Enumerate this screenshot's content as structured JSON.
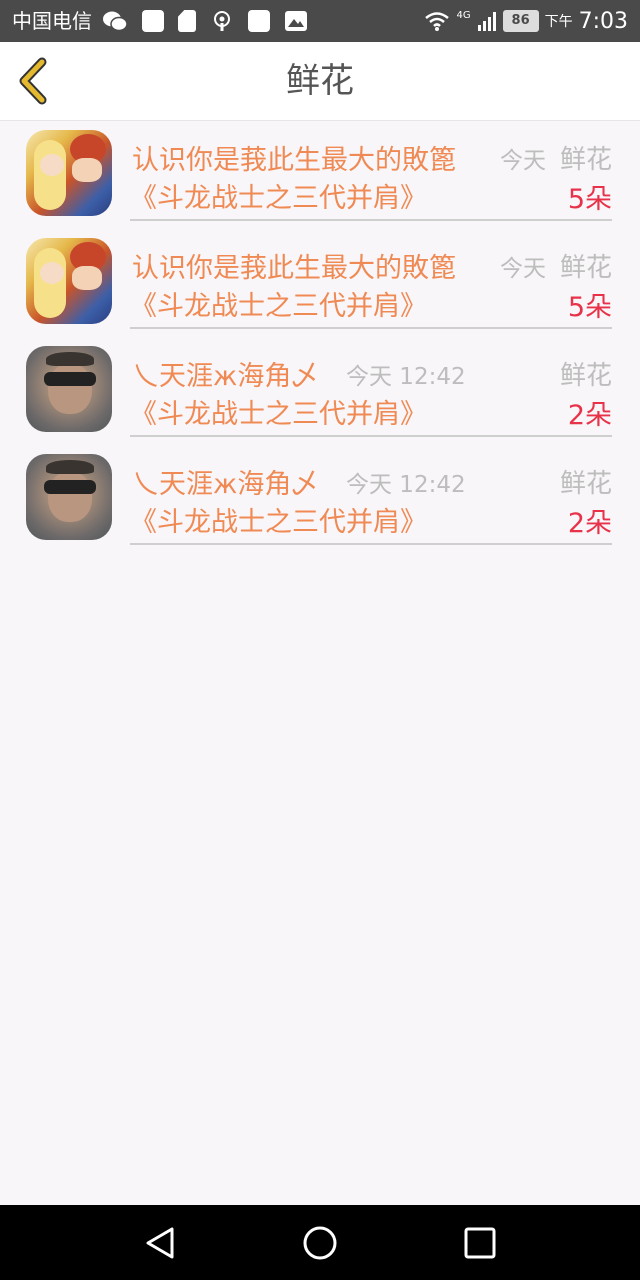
{
  "status_bar": {
    "carrier": "中国电信",
    "network": "4G",
    "battery": "86",
    "ampm": "下午",
    "clock": "7:03"
  },
  "header": {
    "title": "鲜花",
    "back_icon": "chevron-left-icon"
  },
  "items": [
    {
      "name": "认识你是莪此生最大的敗篦",
      "time": "今天",
      "kind": "鲜花",
      "book": "《斗龙战士之三代并肩》",
      "count": "5朵",
      "avatar": "anime-avatar"
    },
    {
      "name": "认识你是莪此生最大的敗篦",
      "time": "今天",
      "kind": "鲜花",
      "book": "《斗龙战士之三代并肩》",
      "count": "5朵",
      "avatar": "anime-avatar"
    },
    {
      "name": "乀天涯ж海角乄",
      "time": "今天 12:42",
      "kind": "鲜花",
      "book": "《斗龙战士之三代并肩》",
      "count": "2朵",
      "avatar": "photo-avatar"
    },
    {
      "name": "乀天涯ж海角乄",
      "time": "今天 12:42",
      "kind": "鲜花",
      "book": "《斗龙战士之三代并肩》",
      "count": "2朵",
      "avatar": "photo-avatar"
    }
  ],
  "colors": {
    "accent": "#f08a54",
    "count": "#e8324a",
    "muted": "#bdbdbd",
    "back_icon": "#e4b92e"
  },
  "nav": {
    "back_icon": "triangle-back-icon",
    "home_icon": "circle-home-icon",
    "recents_icon": "square-recents-icon"
  }
}
